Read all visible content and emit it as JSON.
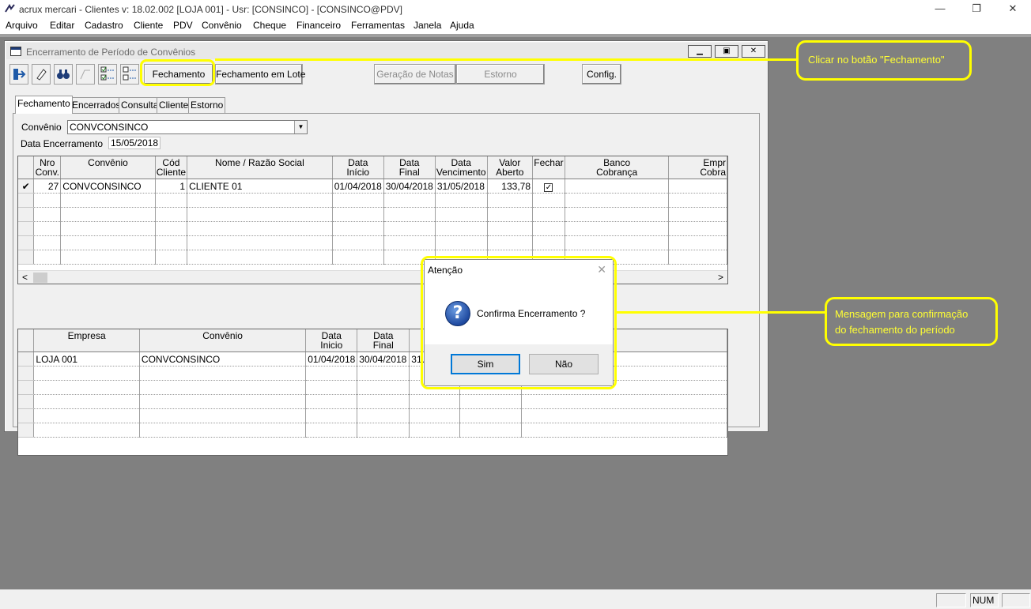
{
  "app": {
    "title": "acrux mercari - Clientes  v: 18.02.002  [LOJA 001] - Usr: [CONSINCO] - [CONSINCO@PDV]",
    "minimize": "—",
    "restore": "❐",
    "close": "✕"
  },
  "menu": [
    "Arquivo",
    "Editar",
    "Cadastro",
    "Cliente",
    "PDV",
    "Convênio",
    "Cheque",
    "Financeiro",
    "Ferramentas",
    "Janela",
    "Ajuda"
  ],
  "window": {
    "title": "Encerramento de Período de Convênios"
  },
  "toolbar": {
    "fechamento": "Fechamento",
    "fechamento_lote": "Fechamento em Lote",
    "geracao_notas": "Geração de Notas",
    "estorno": "Estorno",
    "config": "Config."
  },
  "tabs": [
    "Fechamento",
    "Encerrados",
    "Consulta",
    "Cliente",
    "Estorno"
  ],
  "form": {
    "convenio_label": "Convênio",
    "convenio_value": "CONVCONSINCO",
    "data_label": "Data Encerramento",
    "data_value": "15/05/2018"
  },
  "grid1": {
    "headers": [
      [
        "Nro",
        "Conv."
      ],
      [
        "Convênio",
        ""
      ],
      [
        "Cód",
        "Cliente"
      ],
      [
        "Nome / Razão Social",
        ""
      ],
      [
        "Data",
        "Início"
      ],
      [
        "Data",
        "Final"
      ],
      [
        "Data",
        "Vencimento"
      ],
      [
        "Valor",
        "Aberto"
      ],
      [
        "Fechar",
        ""
      ],
      [
        "Banco",
        "Cobrança"
      ],
      [
        "Empr",
        "Cobra"
      ]
    ],
    "row": {
      "marker": "✔",
      "nro": "27",
      "convenio": "CONVCONSINCO",
      "cod": "1",
      "nome": "CLIENTE 01",
      "inicio": "01/04/2018",
      "final": "30/04/2018",
      "vencimento": "31/05/2018",
      "valor": "133,78",
      "fechar": "✓"
    }
  },
  "grid2": {
    "headers": [
      [
        "Empresa",
        ""
      ],
      [
        "Convênio",
        ""
      ],
      [
        "Data",
        "Inicio"
      ],
      [
        "Data",
        "Final"
      ],
      [
        "Ve",
        ""
      ]
    ],
    "row": {
      "empresa": "LOJA 001",
      "convenio": "CONVCONSINCO",
      "inicio": "01/04/2018",
      "final": "30/04/2018",
      "ve": "31.."
    }
  },
  "dialog": {
    "title": "Atenção",
    "message": "Confirma Encerramento ?",
    "yes": "Sim",
    "no": "Não",
    "close": "✕",
    "icon_glyph": "?"
  },
  "annotations": {
    "callout1": "Clicar no botão \"Fechamento\"",
    "callout2_line1": "Mensagem para confirmação",
    "callout2_line2": "do fechamento do período",
    "highlight_color": "#ffff00"
  },
  "status": {
    "num": "NUM"
  }
}
